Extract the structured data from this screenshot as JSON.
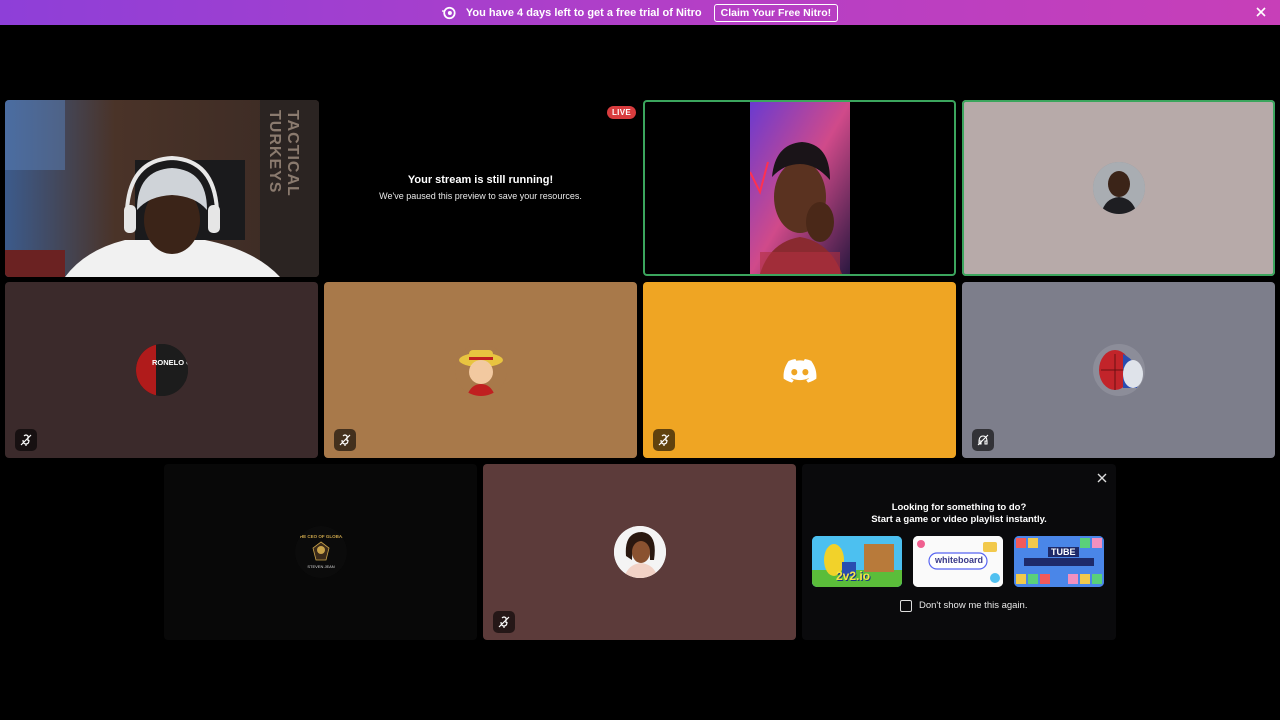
{
  "banner": {
    "message": "You have 4 days left to get a free trial of Nitro",
    "cta_label": "Claim Your Free Nitro!"
  },
  "stream": {
    "live_badge": "LIVE",
    "paused_title": "Your stream is still running!",
    "paused_subtitle": "We've paused this preview to save your resources."
  },
  "webcam": {
    "background_sign": "TACTICAL TURKEYS"
  },
  "avatars": {
    "global_top": "THE CEO OF GLOBAL",
    "global_bottom": "STEVEN JEAN",
    "gaming_text": "RONELO GAMI"
  },
  "activity_panel": {
    "title_line1": "Looking for something to do?",
    "title_line2": "Start a game or video playlist instantly.",
    "activities": [
      {
        "label": "2v2.io"
      },
      {
        "label": "whiteboard"
      },
      {
        "label": "TUBE"
      }
    ],
    "dont_show_label": "Don't show me this again."
  },
  "colors": {
    "tile_dark_brown": "#3b2a2b",
    "tile_tan": "#a8794a",
    "tile_discord_orange": "#efa523",
    "tile_gray": "#7d7e8b",
    "tile_gray_light": "#b7aaa9",
    "tile_mauve": "#5c3b3a",
    "speaking_ring": "#3ba55d"
  }
}
